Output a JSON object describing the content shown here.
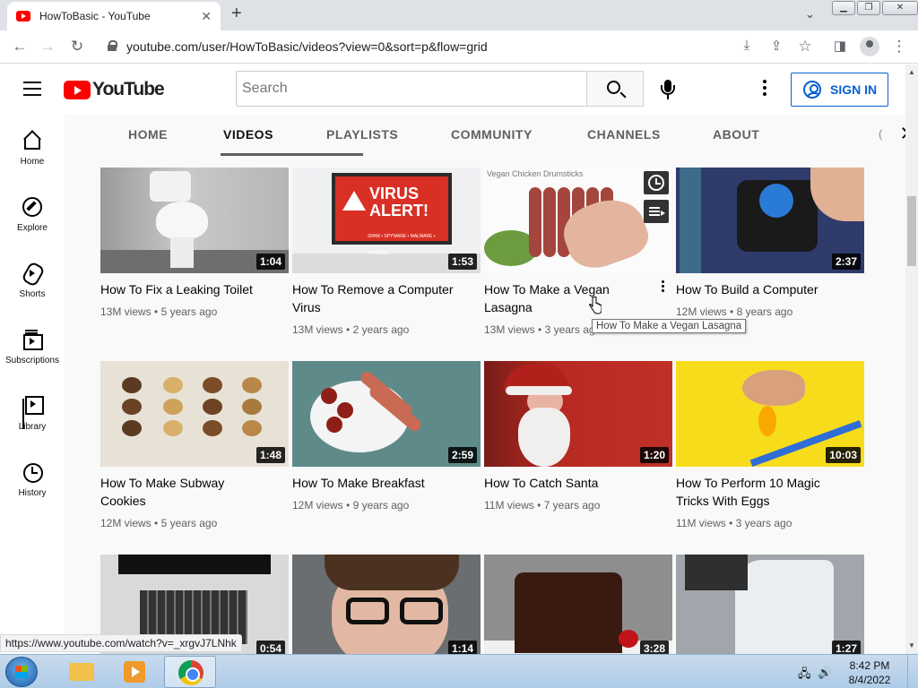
{
  "browser": {
    "tab_title": "HowToBasic - YouTube",
    "new_tab": "+",
    "close_tab": "✕",
    "url": "youtube.com/user/HowToBasic/videos?view=0&sort=p&flow=grid",
    "status_url": "https://www.youtube.com/watch?v=_xrgvJ7LNhk"
  },
  "masthead": {
    "logo_text": "YouTube",
    "search_placeholder": "Search",
    "sign_in": "SIGN IN"
  },
  "guide": [
    {
      "label": "Home",
      "icon": "home-icon"
    },
    {
      "label": "Explore",
      "icon": "compass-icon"
    },
    {
      "label": "Shorts",
      "icon": "shorts-icon"
    },
    {
      "label": "Subscriptions",
      "icon": "subscriptions-icon"
    },
    {
      "label": "Library",
      "icon": "library-icon"
    },
    {
      "label": "History",
      "icon": "history-icon"
    }
  ],
  "channel_tabs": [
    {
      "label": "HOME",
      "active": false
    },
    {
      "label": "VIDEOS",
      "active": true
    },
    {
      "label": "PLAYLISTS",
      "active": false
    },
    {
      "label": "COMMUNITY",
      "active": false
    },
    {
      "label": "CHANNELS",
      "active": false
    },
    {
      "label": "ABOUT",
      "active": false
    }
  ],
  "tabs_overflow": "(",
  "videos": [
    {
      "title": "How To Fix a Leaking Toilet",
      "views": "13M views",
      "age": "5 years ago",
      "duration": "1:04"
    },
    {
      "title": "How To Remove a Computer Virus",
      "views": "13M views",
      "age": "2 years ago",
      "duration": "1:53"
    },
    {
      "title": "How To Make a Vegan Lasagna",
      "views": "13M views",
      "age": "3 years ago",
      "duration": ""
    },
    {
      "title": "How To Build a Computer",
      "views": "12M views",
      "age": "8 years ago",
      "duration": "2:37"
    },
    {
      "title": "How To Make Subway Cookies",
      "views": "12M views",
      "age": "5 years ago",
      "duration": "1:48"
    },
    {
      "title": "How To Make Breakfast",
      "views": "12M views",
      "age": "9 years ago",
      "duration": "2:59"
    },
    {
      "title": "How To Catch Santa",
      "views": "11M views",
      "age": "7 years ago",
      "duration": "1:20"
    },
    {
      "title": "How To Perform 10 Magic Tricks With Eggs",
      "views": "11M views",
      "age": "3 years ago",
      "duration": "10:03"
    },
    {
      "title": "",
      "views": "",
      "age": "",
      "duration": "0:54"
    },
    {
      "title": "",
      "views": "",
      "age": "",
      "duration": "1:14"
    },
    {
      "title": "",
      "views": "",
      "age": "",
      "duration": "3:28"
    },
    {
      "title": "",
      "views": "",
      "age": "",
      "duration": "1:27"
    }
  ],
  "thumb_texts": {
    "virus_line1": "VIRUS",
    "virus_line2": "ALERT!",
    "virus_small": "SPAM • SPYWARE • MALWARE • PHISHING",
    "lasagna_caption": "Vegan Chicken Drumsticks"
  },
  "tooltip": "How To Make a Vegan Lasagna",
  "taskbar": {
    "time": "8:42 PM",
    "date": "8/4/2022"
  }
}
